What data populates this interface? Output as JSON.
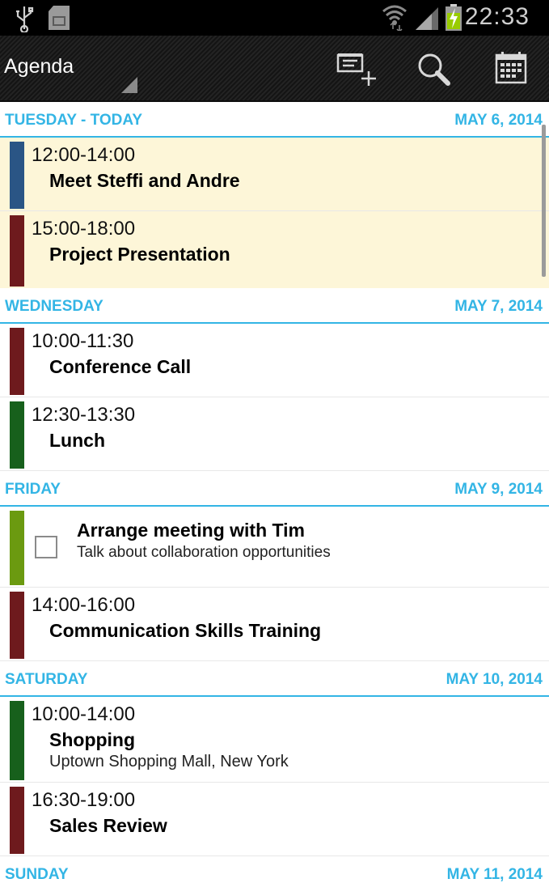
{
  "status_bar": {
    "time": "22:33",
    "icons": [
      "usb-icon",
      "sd-card-icon",
      "wifi-icon",
      "signal-icon",
      "battery-charging-icon"
    ]
  },
  "action_bar": {
    "title": "Agenda",
    "actions": [
      {
        "name": "new-event",
        "icon": "new-event-icon"
      },
      {
        "name": "search",
        "icon": "search-icon"
      },
      {
        "name": "goto-today",
        "icon": "calendar-icon"
      }
    ]
  },
  "days": [
    {
      "name": "TUESDAY - TODAY",
      "date": "MAY 6, 2014",
      "events": [
        {
          "time": "12:00-14:00",
          "title": "Meet Steffi and Andre",
          "color": "#2a5585"
        },
        {
          "time": "15:00-18:00",
          "title": "Project Presentation",
          "color": "#6e1a1d"
        }
      ]
    },
    {
      "name": "WEDNESDAY",
      "date": "MAY 7, 2014",
      "events": [
        {
          "time": "10:00-11:30",
          "title": "Conference Call",
          "color": "#6e1a1d"
        },
        {
          "time": "12:30-13:30",
          "title": "Lunch",
          "color": "#17601c"
        }
      ]
    },
    {
      "name": "FRIDAY",
      "date": "MAY 9, 2014",
      "task": {
        "title": "Arrange meeting with Tim",
        "note": "Talk about collaboration opportunities",
        "color": "#6b9a10",
        "done": false
      },
      "events": [
        {
          "time": "14:00-16:00",
          "title": "Communication Skills Training",
          "color": "#6e1a1d"
        }
      ]
    },
    {
      "name": "SATURDAY",
      "date": "MAY 10, 2014",
      "events": [
        {
          "time": "10:00-14:00",
          "title": "Shopping",
          "location": "Uptown Shopping Mall, New York",
          "color": "#17601c"
        },
        {
          "time": "16:30-19:00",
          "title": "Sales Review",
          "color": "#6e1a1d"
        }
      ]
    },
    {
      "name": "SUNDAY",
      "date": "MAY 11, 2014"
    }
  ],
  "colors": {
    "accent": "#33b5e5",
    "today_background": "#fdf6d8",
    "action_bar": "#1b1b1b"
  }
}
